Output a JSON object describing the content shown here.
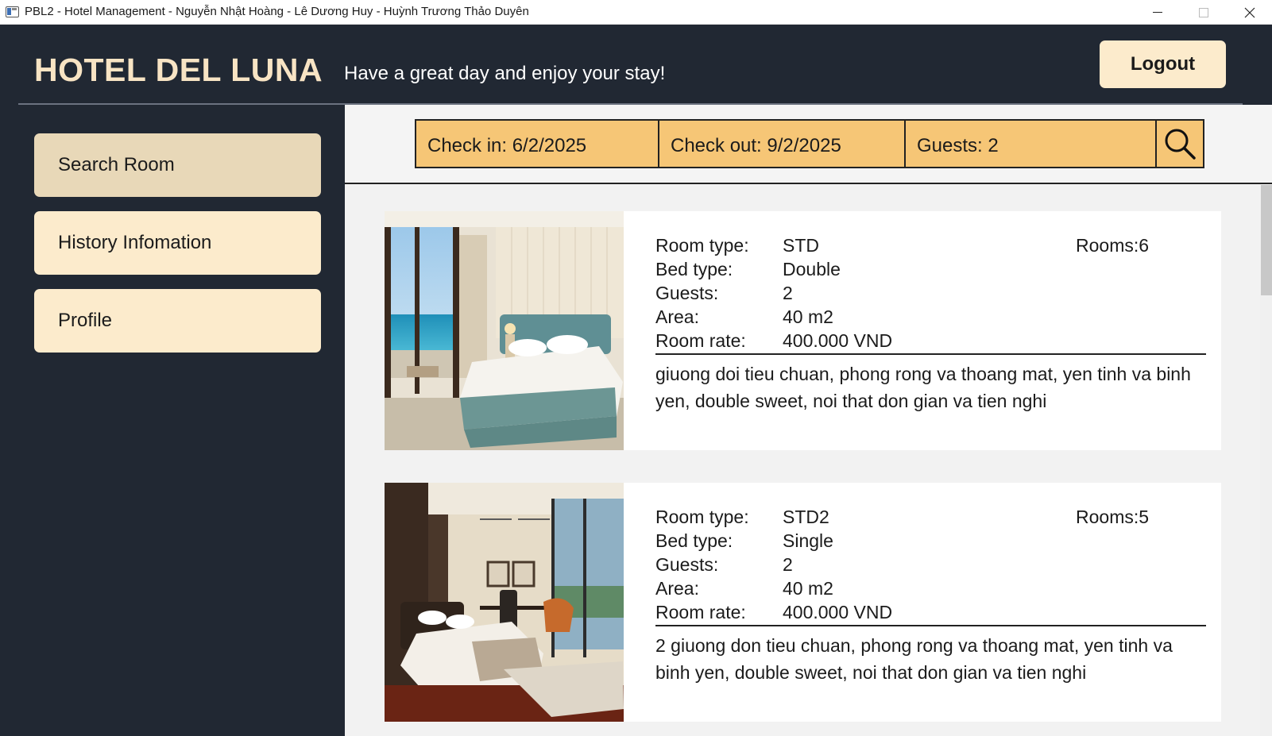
{
  "window": {
    "title": "PBL2 - Hotel Management - Nguyễn Nhật Hoàng - Lê Dương Huy - Huỳnh Trương Thảo Duyên"
  },
  "header": {
    "brand": "HOTEL DEL LUNA",
    "tagline": "Have a great day and enjoy your stay!",
    "logout_label": "Logout"
  },
  "sidebar": {
    "items": [
      {
        "label": "Search Room",
        "active": true
      },
      {
        "label": "History Infomation",
        "active": false
      },
      {
        "label": "Profile",
        "active": false
      }
    ]
  },
  "search": {
    "check_in": "Check in: 6/2/2025",
    "check_out": "Check out: 9/2/2025",
    "guests": "Guests: 2",
    "button_icon": "search-icon"
  },
  "labels": {
    "room_type": "Room type:",
    "bed_type": "Bed type:",
    "guests": "Guests:",
    "area": "Area:",
    "room_rate": "Room rate:"
  },
  "rooms": [
    {
      "room_type": "STD",
      "bed_type": "Double",
      "guests": "2",
      "area": "40 m2",
      "room_rate": "400.000 VND",
      "rooms": "Rooms:6",
      "description": "giuong doi tieu chuan, phong rong va thoang mat, yen tinh va binh yen, double sweet, noi that don gian va tien nghi"
    },
    {
      "room_type": "STD2",
      "bed_type": "Single",
      "guests": "2",
      "area": "40 m2",
      "room_rate": "400.000 VND",
      "rooms": "Rooms:5",
      "description": "2 giuong don tieu chuan, phong rong va thoang mat, yen tinh va binh yen, double sweet, noi that don gian va tien nghi"
    }
  ],
  "colors": {
    "dark_bg": "#212833",
    "brand_text": "#f8e4c4",
    "button_bg": "#fcebcc",
    "active_item": "#e8d8b8",
    "search_field": "#f6c676"
  }
}
